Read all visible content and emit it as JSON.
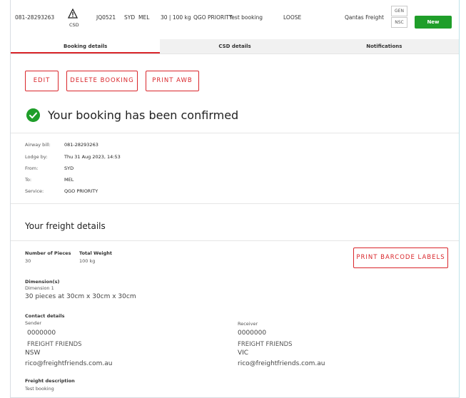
{
  "header": {
    "awb": "081-28293263",
    "csd_label": "CSD",
    "flight": "JQ0521",
    "origin": "SYD",
    "destination": "MEL",
    "pieces_weight": "30 | 100 kg",
    "service": "QGO PRIORITY",
    "description": "Test booking",
    "packing": "LOOSE",
    "carrier": "Qantas Freight",
    "badge_gen": "GEN",
    "badge_nsc": "NSC",
    "status_button": "New"
  },
  "tabs": [
    {
      "label": "Booking details"
    },
    {
      "label": "CSD details"
    },
    {
      "label": "Notifications"
    }
  ],
  "actions": {
    "edit": "EDIT",
    "delete": "DELETE BOOKING",
    "print_awb": "PRINT AWB"
  },
  "confirmation": "Your booking has been confirmed",
  "summary": {
    "airway_bill_label": "Airway bill:",
    "airway_bill": "081-28293263",
    "lodge_by_label": "Lodge by:",
    "lodge_by": "Thu 31 Aug 2023, 14:53",
    "from_label": "From:",
    "from": "SYD",
    "to_label": "To:",
    "to": "MEL",
    "service_label": "Service:",
    "service": "QGO PRIORITY"
  },
  "freight": {
    "title": "Your freight details",
    "pieces_label": "Number of Pieces",
    "pieces": "30",
    "weight_label": "Total Weight",
    "weight": "100 kg",
    "print_barcode": "PRINT BARCODE LABELS",
    "dimensions_label": "Dimension(s)",
    "dimension_1_label": "Dimension 1",
    "dimension_1": "30 pieces at 30cm x 30cm x 30cm",
    "contact_label": "Contact details",
    "sender_label": "Sender",
    "sender_phone": "0000000",
    "sender_name": "FREIGHT FRIENDS",
    "sender_state": "NSW",
    "sender_email": "rico@freightfriends.com.au",
    "receiver_label": "Receiver",
    "receiver_phone": "0000000",
    "receiver_name": "FREIGHT FRIENDS",
    "receiver_state": "VIC",
    "receiver_email": "rico@freightfriends.com.au",
    "description_label": "Freight description",
    "description": "Test booking"
  },
  "colors": {
    "accent_red": "#d9262b",
    "success_green": "#1f9e2a"
  },
  "icons": {
    "warning": "warning-triangle-icon",
    "confirmed": "check-circle-icon"
  }
}
